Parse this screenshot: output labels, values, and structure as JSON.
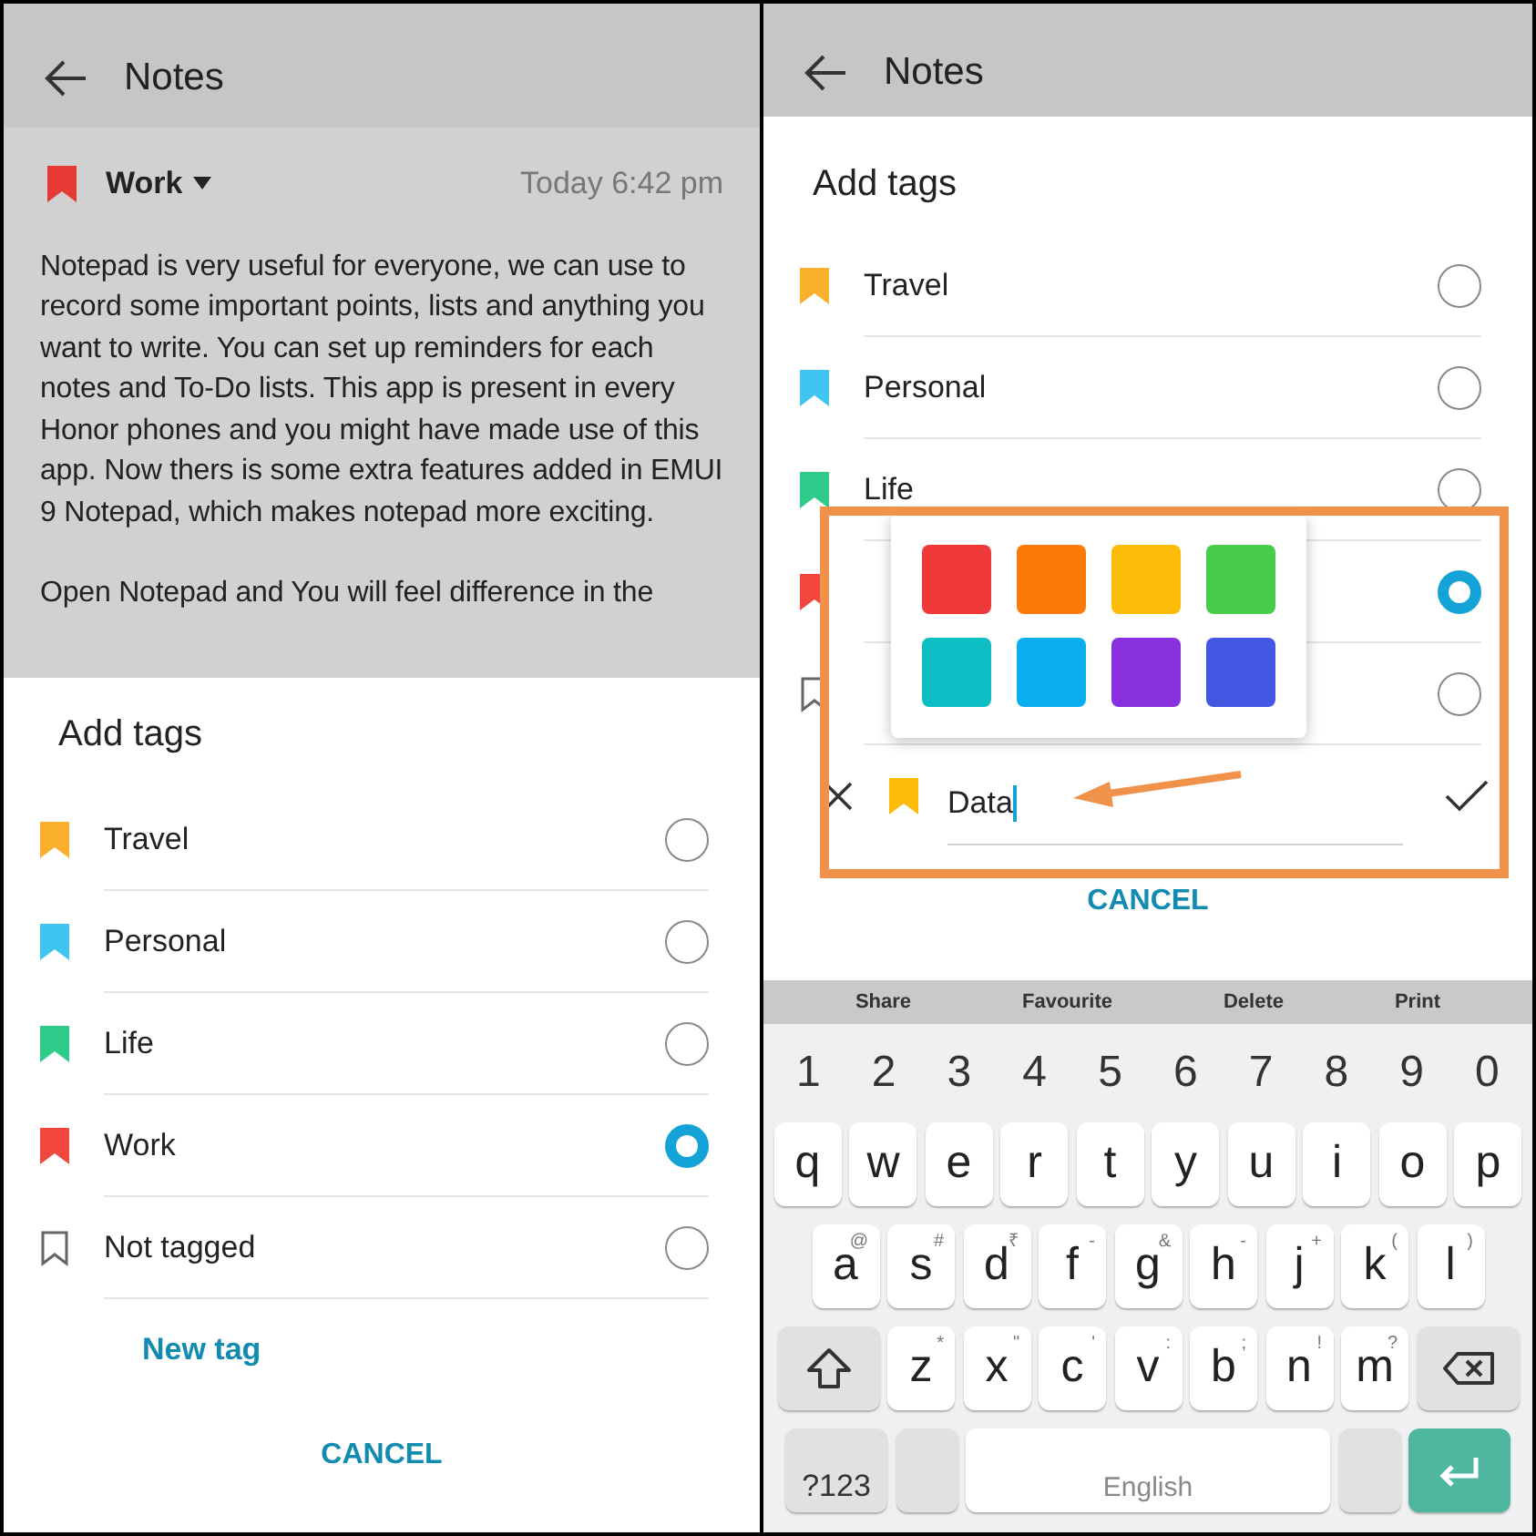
{
  "left": {
    "title": "Notes",
    "note": {
      "tag": "Work",
      "time": "Today 6:42 pm",
      "paragraphs": [
        "Notepad is very useful for everyone, we can use to record some important points, lists and anything you want to write. You can set up reminders for each notes and To-Do lists. This app is present in every Honor phones and you might have made use of this app. Now thers is some extra features added in EMUI 9 Notepad, which makes notepad more exciting.",
        "Open Notepad and You will feel difference in the"
      ]
    },
    "sheet": {
      "title": "Add tags",
      "tags": [
        {
          "kind": "tag",
          "label": "Travel",
          "color": "#fbb02d",
          "selected": false
        },
        {
          "kind": "tag",
          "label": "Personal",
          "color": "#40c4f0",
          "selected": false
        },
        {
          "kind": "tag",
          "label": "Life",
          "color": "#2fcb8a",
          "selected": false
        },
        {
          "kind": "tag",
          "label": "Work",
          "color": "#f2473f",
          "selected": true
        },
        {
          "kind": "none",
          "label": "Not tagged",
          "selected": false
        }
      ],
      "new_tag": "New tag",
      "cancel": "CANCEL"
    }
  },
  "right": {
    "title": "Notes",
    "sheet": {
      "title": "Add tags",
      "tags": [
        {
          "kind": "tag",
          "label": "Travel",
          "color": "#fbb02d",
          "selected": false
        },
        {
          "kind": "tag",
          "label": "Personal",
          "color": "#40c4f0",
          "selected": false
        },
        {
          "kind": "tag",
          "label": "Life",
          "color": "#2fcb8a",
          "selected": false
        },
        {
          "kind": "tag",
          "color": "#f2473f",
          "selected": true
        },
        {
          "kind": "none",
          "selected": false
        }
      ],
      "palette": [
        {
          "color": "#f03a3a"
        },
        {
          "color": "#fb7a0a"
        },
        {
          "color": "#fcbc08"
        },
        {
          "color": "#48cc4c"
        },
        {
          "color": "#0dbfc4"
        },
        {
          "color": "#0aaeee"
        },
        {
          "color": "#882fde"
        },
        {
          "color": "#4258e2"
        }
      ],
      "new_tag": {
        "color": "#fcbc08",
        "value": "Data"
      },
      "cancel": "CANCEL"
    },
    "keyboard": {
      "toolbar": [
        "Share",
        "Favourite",
        "Delete",
        "Print"
      ],
      "numbers": [
        "1",
        "2",
        "3",
        "4",
        "5",
        "6",
        "7",
        "8",
        "9",
        "0"
      ],
      "rows": [
        [
          {
            "kind": "key",
            "label": "q"
          },
          {
            "kind": "key",
            "label": "w"
          },
          {
            "kind": "key",
            "label": "e"
          },
          {
            "kind": "key",
            "label": "r"
          },
          {
            "kind": "key",
            "label": "t"
          },
          {
            "kind": "key",
            "label": "y"
          },
          {
            "kind": "key",
            "label": "u"
          },
          {
            "kind": "key",
            "label": "i"
          },
          {
            "kind": "key",
            "label": "o"
          },
          {
            "kind": "key",
            "label": "p"
          }
        ],
        [
          {
            "kind": "key",
            "label": "a",
            "hint": "@"
          },
          {
            "kind": "key",
            "label": "s",
            "hint": "#"
          },
          {
            "kind": "key",
            "label": "d",
            "hint": "₹"
          },
          {
            "kind": "key",
            "label": "f",
            "hint": "-"
          },
          {
            "kind": "key",
            "label": "g",
            "hint": "&"
          },
          {
            "kind": "key",
            "label": "h",
            "hint": "-"
          },
          {
            "kind": "key",
            "label": "j",
            "hint": "+"
          },
          {
            "kind": "key",
            "label": "k",
            "hint": "("
          },
          {
            "kind": "key",
            "label": "l",
            "hint": ")"
          }
        ],
        [
          {
            "kind": "shift"
          },
          {
            "kind": "key",
            "label": "z",
            "hint": "*"
          },
          {
            "kind": "key",
            "label": "x",
            "hint": "\""
          },
          {
            "kind": "key",
            "label": "c",
            "hint": "'"
          },
          {
            "kind": "key",
            "label": "v",
            "hint": ":"
          },
          {
            "kind": "key",
            "label": "b",
            "hint": ";"
          },
          {
            "kind": "key",
            "label": "n",
            "hint": "!"
          },
          {
            "kind": "key",
            "label": "m",
            "hint": "?"
          },
          {
            "kind": "backspace"
          }
        ]
      ],
      "bottom_bar": {
        "symbols_key": "?123",
        "space_key": "English"
      }
    }
  }
}
